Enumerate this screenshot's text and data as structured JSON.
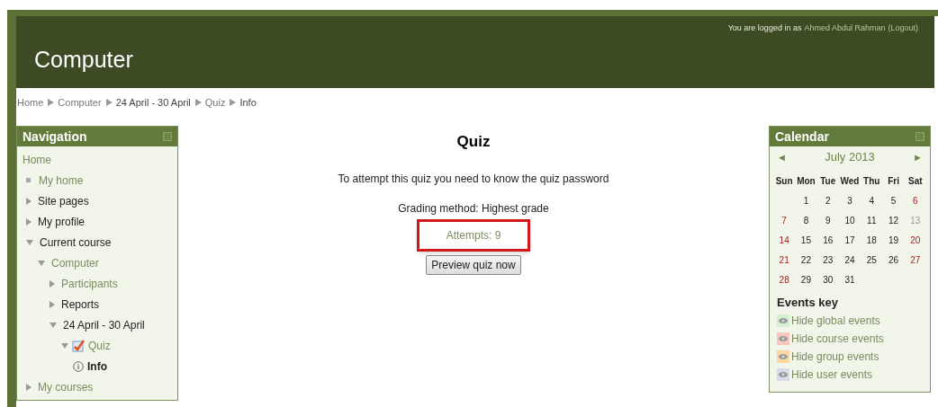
{
  "header": {
    "title": "Computer",
    "login_prefix": "You are logged in as",
    "user": "Ahmed Abdul Rahman",
    "logout": "(Logout)"
  },
  "breadcrumb": [
    "Home",
    "Computer",
    "24 April - 30 April",
    "Quiz",
    "Info"
  ],
  "navigation": {
    "title": "Navigation",
    "items": [
      {
        "label": "Home",
        "kind": "home",
        "link": true
      },
      {
        "label": "My home",
        "kind": "leaf",
        "link": true
      },
      {
        "label": "Site pages",
        "kind": "branch",
        "expanded": false,
        "link": false
      },
      {
        "label": "My profile",
        "kind": "branch",
        "expanded": false,
        "link": false
      },
      {
        "label": "Current course",
        "kind": "branch",
        "expanded": true,
        "link": false,
        "children": [
          {
            "label": "Computer",
            "kind": "branch",
            "expanded": true,
            "link": true,
            "children": [
              {
                "label": "Participants",
                "kind": "branch",
                "expanded": false,
                "link": true
              },
              {
                "label": "Reports",
                "kind": "branch",
                "expanded": false,
                "link": false
              },
              {
                "label": "24 April - 30 April",
                "kind": "branch",
                "expanded": true,
                "link": false,
                "children": [
                  {
                    "label": "Quiz",
                    "kind": "quiz",
                    "expanded": true,
                    "link": true,
                    "children": [
                      {
                        "label": "Info",
                        "kind": "info",
                        "link": false,
                        "current": true
                      }
                    ]
                  }
                ]
              }
            ]
          }
        ]
      },
      {
        "label": "My courses",
        "kind": "branch",
        "expanded": false,
        "link": true
      }
    ]
  },
  "quiz": {
    "title": "Quiz",
    "password_note": "To attempt this quiz you need to know the quiz password",
    "grading": "Grading method: Highest grade",
    "attempts": {
      "text": "Attempts: 9",
      "highlighted": true
    },
    "button": "Preview quiz now"
  },
  "calendar": {
    "title": "Calendar",
    "prev": "◄",
    "month": "July 2013",
    "next": "►",
    "weekdays": [
      "Sun",
      "Mon",
      "Tue",
      "Wed",
      "Thu",
      "Fri",
      "Sat"
    ],
    "weeks": [
      [
        {
          "kind": "blank"
        },
        {
          "day": "1",
          "kind": "weekday"
        },
        {
          "day": "2",
          "kind": "weekday"
        },
        {
          "day": "3",
          "kind": "weekday"
        },
        {
          "day": "4",
          "kind": "weekday"
        },
        {
          "day": "5",
          "kind": "weekday"
        },
        {
          "day": "6",
          "kind": "weekend"
        }
      ],
      [
        {
          "day": "7",
          "kind": "weekend"
        },
        {
          "day": "8",
          "kind": "weekday"
        },
        {
          "day": "9",
          "kind": "weekday"
        },
        {
          "day": "10",
          "kind": "weekday"
        },
        {
          "day": "11",
          "kind": "weekday"
        },
        {
          "day": "12",
          "kind": "weekday"
        },
        {
          "day": "13",
          "kind": "today"
        }
      ],
      [
        {
          "day": "14",
          "kind": "weekend"
        },
        {
          "day": "15",
          "kind": "weekday"
        },
        {
          "day": "16",
          "kind": "weekday"
        },
        {
          "day": "17",
          "kind": "weekday"
        },
        {
          "day": "18",
          "kind": "weekday"
        },
        {
          "day": "19",
          "kind": "weekday"
        },
        {
          "day": "20",
          "kind": "weekend"
        }
      ],
      [
        {
          "day": "21",
          "kind": "weekend"
        },
        {
          "day": "22",
          "kind": "weekday"
        },
        {
          "day": "23",
          "kind": "weekday"
        },
        {
          "day": "24",
          "kind": "weekday"
        },
        {
          "day": "25",
          "kind": "weekday"
        },
        {
          "day": "26",
          "kind": "weekday"
        },
        {
          "day": "27",
          "kind": "weekend"
        }
      ],
      [
        {
          "day": "28",
          "kind": "weekend"
        },
        {
          "day": "29",
          "kind": "weekday"
        },
        {
          "day": "30",
          "kind": "weekday"
        },
        {
          "day": "31",
          "kind": "weekday"
        },
        {
          "kind": "blank"
        },
        {
          "kind": "blank"
        },
        {
          "kind": "blank"
        }
      ]
    ],
    "events_title": "Events key",
    "events": [
      {
        "label": "Hide global events",
        "color": "#d4f0d0"
      },
      {
        "label": "Hide course events",
        "color": "#f8c8c0"
      },
      {
        "label": "Hide group events",
        "color": "#fbd8a0"
      },
      {
        "label": "Hide user events",
        "color": "#d8dce8"
      }
    ]
  }
}
